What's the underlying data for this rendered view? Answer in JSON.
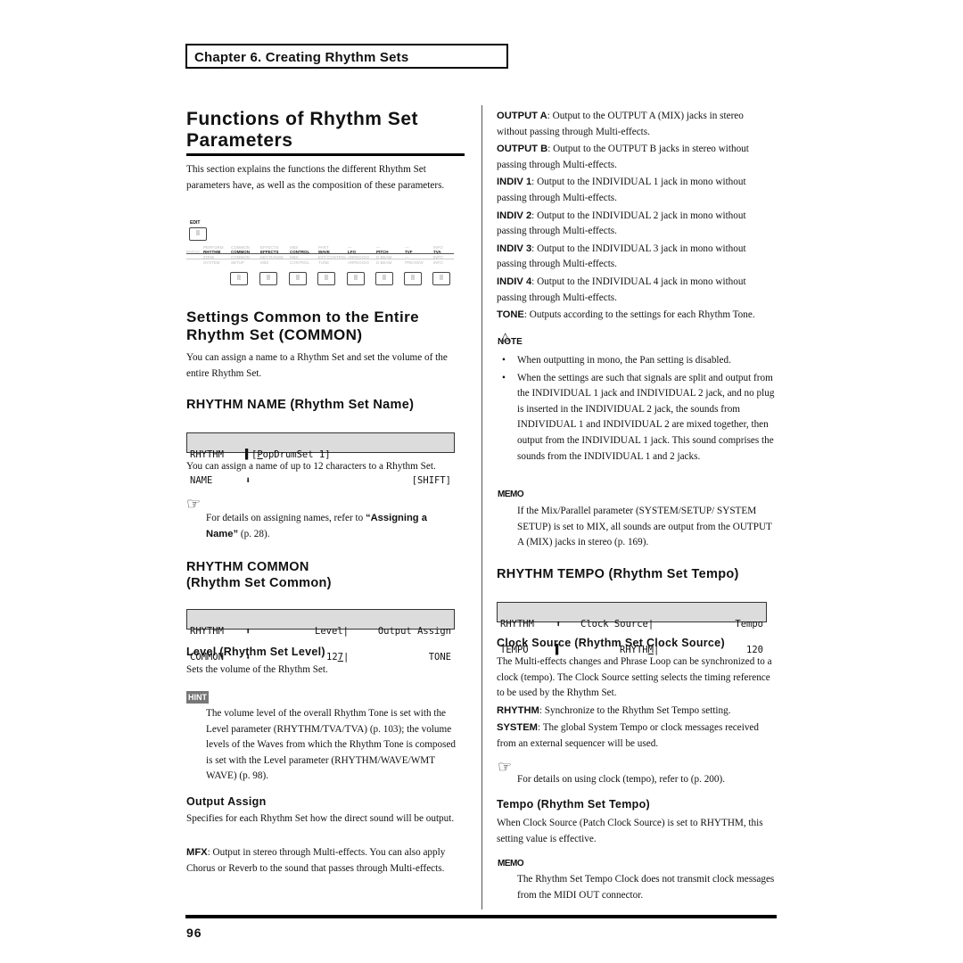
{
  "header": {
    "chapter": "Chapter 6. Creating Rhythm Sets"
  },
  "left": {
    "title_line1": "Functions of Rhythm Set",
    "title_line2": "Parameters",
    "intro": "This section explains the functions the different Rhythm Set parameters have, as well as the composition of these parameters.",
    "panel": {
      "edit_label": "EDIT",
      "button_icon": "keypad-icon",
      "rows": {
        "top": [
          "PERFORM",
          "COMMON",
          "EFFECTS",
          "MIDI",
          "PART",
          "—",
          "—",
          "—",
          "INFO"
        ],
        "main_prefix": "PATCH",
        "main": [
          "RHYTHM",
          "COMMON",
          "EFFECTS",
          "CONTROL",
          "WAVE",
          "LFO",
          "PITCH",
          "TVF",
          "TVA"
        ],
        "sub1": [
          "ZONE",
          "COMMON",
          "KEY RANGE",
          "MIDI",
          "EXT CONTROL",
          "ARPEGGIO",
          "D BEAM",
          "—",
          "INFO"
        ],
        "sub2": [
          "SYSTEM",
          "SETUP",
          "MIDI",
          "CONTROL",
          "TUNE",
          "ARPEGGIO",
          "D BEAM",
          "PREVIEW",
          "INFO"
        ]
      }
    },
    "section_common_line1": "Settings Common to the Entire",
    "section_common_line2": "Rhythm Set (COMMON)",
    "common_intro": "You can assign a name to a Rhythm Set and set the volume of the entire Rhythm Set.",
    "rhythm_name_heading": "RHYTHM NAME (Rhythm Set Name)",
    "lcd_name": {
      "l1": "RHYTHM",
      "l2": "NAME",
      "value_prefix": "[",
      "value_cursor": "P",
      "value_rest": "opDrumSet 1]",
      "shift": "[SHIFT]"
    },
    "name_desc": "You can assign a name of up to 12 characters to a Rhythm Set.",
    "name_ref_prefix": "For details on assigning names, refer to ",
    "name_ref_bold": "“Assigning a Name”",
    "name_ref_suffix": " (p. 28).",
    "rhythm_common_heading_line1": "RHYTHM COMMON",
    "rhythm_common_heading_line2": "(Rhythm Set Common)",
    "lcd_common": {
      "l1": "RHYTHM",
      "l2": "COMMON",
      "level_label": "Level|",
      "level_value_a": "12",
      "level_value_cursor": "7",
      "level_value_b": "|",
      "output_label": "Output Assign",
      "output_value": "TONE"
    },
    "level_heading": "Level (Rhythm Set Level)",
    "level_desc": "Sets the volume of the Rhythm Set.",
    "hint_label": "HINT",
    "hint_text": "The volume level of the overall Rhythm Tone is set with the Level parameter (RHYTHM/TVA/TVA) (p. 103); the volume levels of the Waves from which the Rhythm Tone is composed is set with the Level parameter (RHYTHM/WAVE/WMT WAVE) (p. 98).",
    "output_assign_heading": "Output Assign",
    "output_assign_desc": "Specifies for each Rhythm Set how the direct sound will be output.",
    "mfx_term": "MFX",
    "mfx_desc": ": Output in stereo through Multi-effects. You can also apply Chorus or Reverb to the sound that passes through Multi-effects."
  },
  "right": {
    "outputs": [
      {
        "term": "OUTPUT A",
        "desc": ": Output to the OUTPUT A (MIX) jacks in stereo without passing through Multi-effects."
      },
      {
        "term": "OUTPUT B",
        "desc": ": Output to the OUTPUT B jacks in stereo without passing through Multi-effects."
      },
      {
        "term": "INDIV 1",
        "desc": ": Output to the INDIVIDUAL 1 jack in mono without passing through Multi-effects."
      },
      {
        "term": "INDIV 2",
        "desc": ": Output to the INDIVIDUAL 2 jack in mono without passing through Multi-effects."
      },
      {
        "term": "INDIV 3",
        "desc": ": Output to the INDIVIDUAL 3 jack in mono without passing through Multi-effects."
      },
      {
        "term": "INDIV 4",
        "desc": ": Output to the INDIVIDUAL 4 jack in mono without passing through Multi-effects."
      },
      {
        "term": "TONE",
        "desc": ": Outputs according to the settings for each Rhythm Tone."
      }
    ],
    "note_label": "NOTE",
    "note_items": [
      "When outputting in mono, the Pan setting is disabled.",
      "When the settings are such that signals are split and output from the INDIVIDUAL 1 jack and INDIVIDUAL 2 jack, and no plug is inserted in the INDIVIDUAL 2 jack, the sounds from INDIVIDUAL 1 and INDIVIDUAL 2 are mixed together, then output from the INDIVIDUAL 1 jack. This sound comprises the sounds from the INDIVIDUAL 1 and 2 jacks."
    ],
    "memo_label": "MEMO",
    "memo1_text": "If the Mix/Parallel parameter (SYSTEM/SETUP/ SYSTEM SETUP) is set to MIX, all sounds are output from the OUTPUT A (MIX) jacks in stereo (p. 169).",
    "tempo_heading": "RHYTHM TEMPO (Rhythm Set Tempo)",
    "lcd_tempo": {
      "l1": "RHYTHM",
      "l2": "TEMPO",
      "clock_label": "Clock Source|",
      "clock_value_a": "RHYTH",
      "clock_value_cursor": "M",
      "clock_value_b": "|",
      "tempo_label": "Tempo",
      "tempo_value": "120"
    },
    "clock_heading": "Clock Source (Rhythm Set Clock Source)",
    "clock_desc": "The Multi-effects changes and Phrase Loop can be synchronized to a clock (tempo). The Clock Source setting selects the timing reference to be used by the Rhythm Set.",
    "rhythm_term": "RHYTHM",
    "rhythm_desc": ": Synchronize to the Rhythm Set Tempo setting.",
    "system_term": "SYSTEM",
    "system_desc": ": The global System Tempo or clock messages received from an external sequencer will be used.",
    "clock_ref": "For details on using clock (tempo), refer to (p. 200).",
    "tempo_sub_heading": "Tempo (Rhythm Set Tempo)",
    "tempo_desc": "When Clock Source (Patch Clock Source) is set to RHYTHM, this setting value is effective.",
    "memo2_text": "The Rhythm Set Tempo Clock does not transmit clock messages from the MIDI OUT connector."
  },
  "footer": {
    "page_number": "96"
  }
}
